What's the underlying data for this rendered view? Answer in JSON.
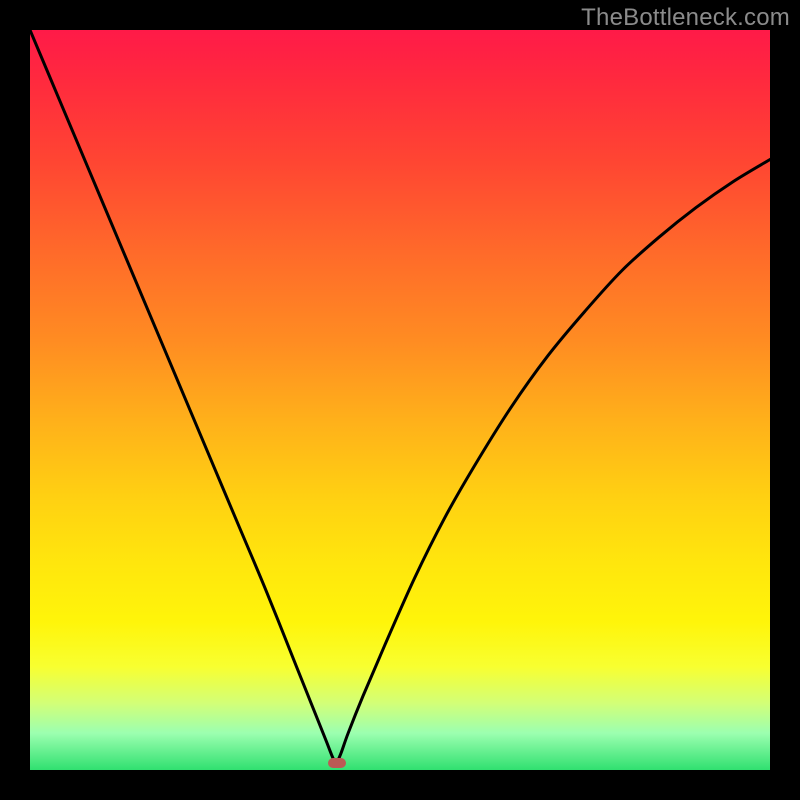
{
  "watermark": "TheBottleneck.com",
  "colors": {
    "frame": "#000000",
    "watermark": "#8b8b8b",
    "curve": "#000000",
    "marker": "#bb5a55",
    "gradient_top": "#ff1a48",
    "gradient_mid": "#ffe60d",
    "gradient_bottom": "#30e070"
  },
  "chart_data": {
    "type": "line",
    "title": "",
    "xlabel": "",
    "ylabel": "",
    "xlim": [
      0,
      100
    ],
    "ylim": [
      0,
      100
    ],
    "grid": false,
    "legend": false,
    "series": [
      {
        "name": "bottleneck-curve",
        "x": [
          0,
          4,
          8,
          12,
          16,
          20,
          24,
          28,
          32,
          36,
          38,
          40,
          41,
          41.5,
          42,
          43,
          45,
          48,
          52,
          56,
          60,
          65,
          70,
          75,
          80,
          85,
          90,
          95,
          100
        ],
        "y": [
          100,
          90.5,
          81,
          71.5,
          62,
          52.5,
          43,
          33.5,
          24,
          14,
          9,
          4,
          1.5,
          1.2,
          2.2,
          5,
          10,
          17,
          26,
          34,
          41,
          49,
          56,
          62,
          67.5,
          72,
          76,
          79.5,
          82.5
        ]
      }
    ],
    "marker": {
      "x": 41.5,
      "y": 1.0
    }
  }
}
